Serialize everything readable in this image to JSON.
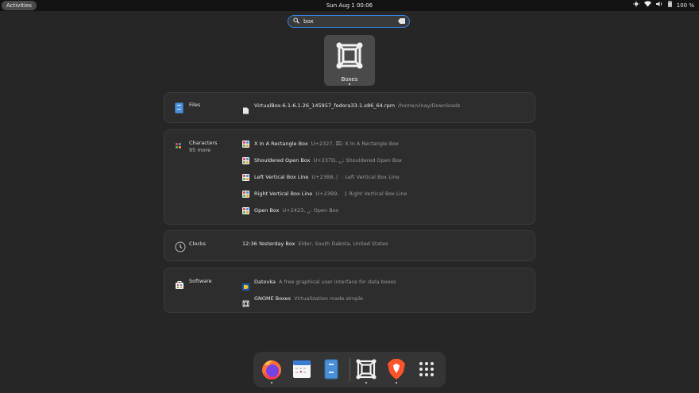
{
  "topbar": {
    "activities_label": "Activities",
    "clock": "Sun Aug 1  00:06",
    "battery": "100 %",
    "icons": [
      "night-light-icon",
      "wifi-icon",
      "volume-icon",
      "battery-icon"
    ]
  },
  "search": {
    "value": "box"
  },
  "app_result": {
    "label": "Boxes",
    "icon": "boxes-icon"
  },
  "groups": {
    "files": {
      "name": "Files",
      "icon": "files-icon",
      "rows": [
        {
          "title": "VirtualBox-6.1-6.1.26_145957_fedora33-1.x86_64.rpm",
          "desc": "/home/vinay/Downloads",
          "icon": "file-icon"
        }
      ]
    },
    "characters": {
      "name": "Characters",
      "more": "95 more",
      "icon": "characters-icon",
      "rows": [
        {
          "title": "X In A Rectangle Box",
          "desc": "U+2327, ⌧: X In A Rectangle Box"
        },
        {
          "title": "Shouldered Open Box",
          "desc": "U+237D, ⍽: Shouldered Open Box"
        },
        {
          "title": "Left Vertical Box Line",
          "desc": "U+23B8, ⎸: Left Vertical Box Line"
        },
        {
          "title": "Right Vertical Box Line",
          "desc": "U+23B9, ⎹: Right Vertical Box Line"
        },
        {
          "title": "Open Box",
          "desc": "U+2423, ␣: Open Box"
        }
      ]
    },
    "clocks": {
      "name": "Clocks",
      "icon": "clock-icon",
      "rows": [
        {
          "title": "12:36 Yesterday  Box",
          "desc": "Elder, South Dakota, United States"
        }
      ]
    },
    "software": {
      "name": "Software",
      "icon": "software-icon",
      "rows": [
        {
          "title": "Datovka",
          "desc": "A free graphical user interface for data boxes",
          "icon": "datovka-icon"
        },
        {
          "title": "GNOME Boxes",
          "desc": "Virtualization made simple",
          "icon": "boxes-icon"
        }
      ]
    }
  },
  "dash": {
    "items": [
      {
        "name": "firefox-icon",
        "running": true
      },
      {
        "name": "calendar-icon",
        "running": false
      },
      {
        "name": "files-icon",
        "running": false
      },
      {
        "name": "boxes-icon",
        "running": true
      },
      {
        "name": "brave-icon",
        "running": true
      },
      {
        "name": "show-apps-icon",
        "running": false
      }
    ]
  },
  "colors": {
    "accent": "#3584e4",
    "background": "#262626",
    "topbar": "#131313",
    "card": "#2d2d2d",
    "dash": "#353535"
  }
}
